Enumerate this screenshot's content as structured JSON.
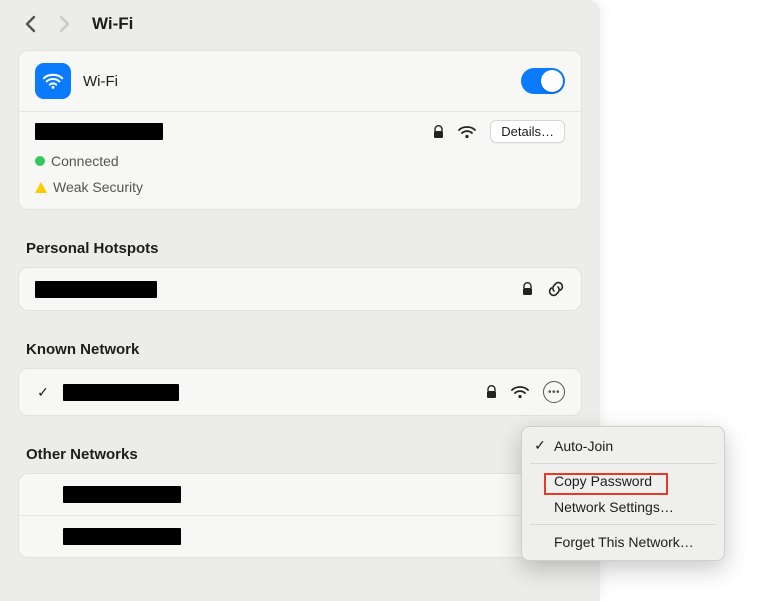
{
  "page": {
    "title": "Wi-Fi"
  },
  "wifi": {
    "label": "Wi-Fi",
    "enabled": true,
    "details_button": "Details…",
    "status_connected": "Connected",
    "status_weak_security": "Weak Security"
  },
  "sections": {
    "personal_hotspots": "Personal Hotspots",
    "known_network": "Known Network",
    "other_networks": "Other Networks"
  },
  "context_menu": {
    "auto_join": "Auto-Join",
    "copy_password": "Copy Password",
    "network_settings": "Network Settings…",
    "forget": "Forget This Network…"
  }
}
